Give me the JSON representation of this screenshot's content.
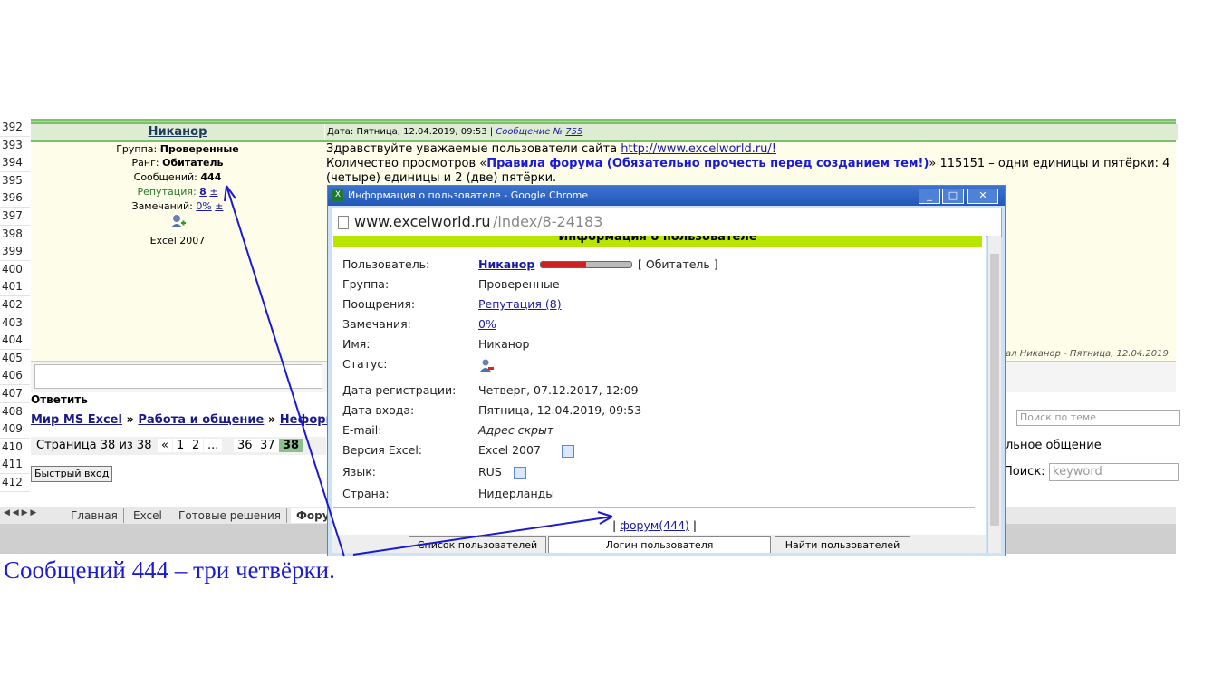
{
  "rows": [
    "392",
    "393",
    "394",
    "395",
    "396",
    "397",
    "398",
    "399",
    "400",
    "401",
    "402",
    "403",
    "404",
    "405",
    "406",
    "407",
    "408",
    "409",
    "410",
    "411",
    "412"
  ],
  "post": {
    "user": "Никанор",
    "header_date": "Дата: Пятница, 12.04.2019, 09:53",
    "header_msg": "Сообщение №",
    "header_msg_num": "755",
    "group_label": "Группа:",
    "group": "Проверенные",
    "rank_label": "Ранг:",
    "rank": "Обитатель",
    "msgs_label": "Сообщений:",
    "msgs": "444",
    "rep_label": "Репутация:",
    "rep": "8",
    "pm": "±",
    "warn_label": "Замечаний:",
    "warn": "0%",
    "excel": "Excel 2007",
    "line1": "Здравствуйте уважаемые пользователи сайта ",
    "line1_link": "http://www.excelworld.ru/!",
    "line2_pre": "Количество просмотров «",
    "line2_bold": "Правила форума (Обязательно прочесть перед созданием тем!)",
    "line2_post": "» 115151 – одни единицы и пятёрки: 4",
    "line3": "(четыре) единицы и 2 (две) пятёрки.",
    "edited": "ал Никанор - Пятница, 12.04.2019",
    "reply": "Ответить"
  },
  "nav": {
    "crumb1": "Мир MS Excel",
    "sep": "»",
    "crumb2": "Работа и общение",
    "crumb3": "Неформ",
    "pages": "Страница 38 из 38",
    "pagelinks": [
      "«",
      "1",
      "2",
      "...",
      "36",
      "37",
      "38"
    ],
    "fast_login": "Быстрый вход",
    "search_topic_placeholder": "Поиск по теме",
    "right_text": "льное общение",
    "search_label": "Поиск:",
    "search_placeholder": "keyword"
  },
  "tabs": [
    "Главная",
    "Excel",
    "Готовые решения",
    "Фору"
  ],
  "popup": {
    "title": "Информация о пользователе - Google Chrome",
    "url_host": "www.excelworld.ru",
    "url_path": "/index/8-24183",
    "header": "Информация о пользователе",
    "fields": [
      {
        "label": "Пользователь:",
        "value": "Никанор",
        "extra": "[ Обитатель ]"
      },
      {
        "label": "Группа:",
        "value": "Проверенные"
      },
      {
        "label": "Поощрения:",
        "value": "Репутация (8)"
      },
      {
        "label": "Замечания:",
        "value": "0%"
      },
      {
        "label": "Имя:",
        "value": "Никанор"
      },
      {
        "label": "Статус:",
        "value": ""
      },
      {
        "label": "Дата регистрации:",
        "value": "Четверг, 07.12.2017, 12:09"
      },
      {
        "label": "Дата входа:",
        "value": "Пятница, 12.04.2019, 09:53"
      },
      {
        "label": "E-mail:",
        "value": "Адрес скрыт"
      },
      {
        "label": "Версия Excel:",
        "value": "Excel 2007"
      },
      {
        "label": "Язык:",
        "value": "RUS"
      },
      {
        "label": "Страна:",
        "value": "Нидерланды"
      }
    ],
    "forum_link": "форум(444)",
    "bar": "|",
    "btn_users": "Список пользователей",
    "btn_login": "Логин пользователя",
    "btn_find": "Найти пользователей"
  },
  "annotation": "Сообщений 444 – три четвёрки.",
  "colors": {
    "arrow": "#1a1ad6",
    "link": "#1a1aa6",
    "green": "#a6dc96",
    "title": "#2358b8"
  }
}
